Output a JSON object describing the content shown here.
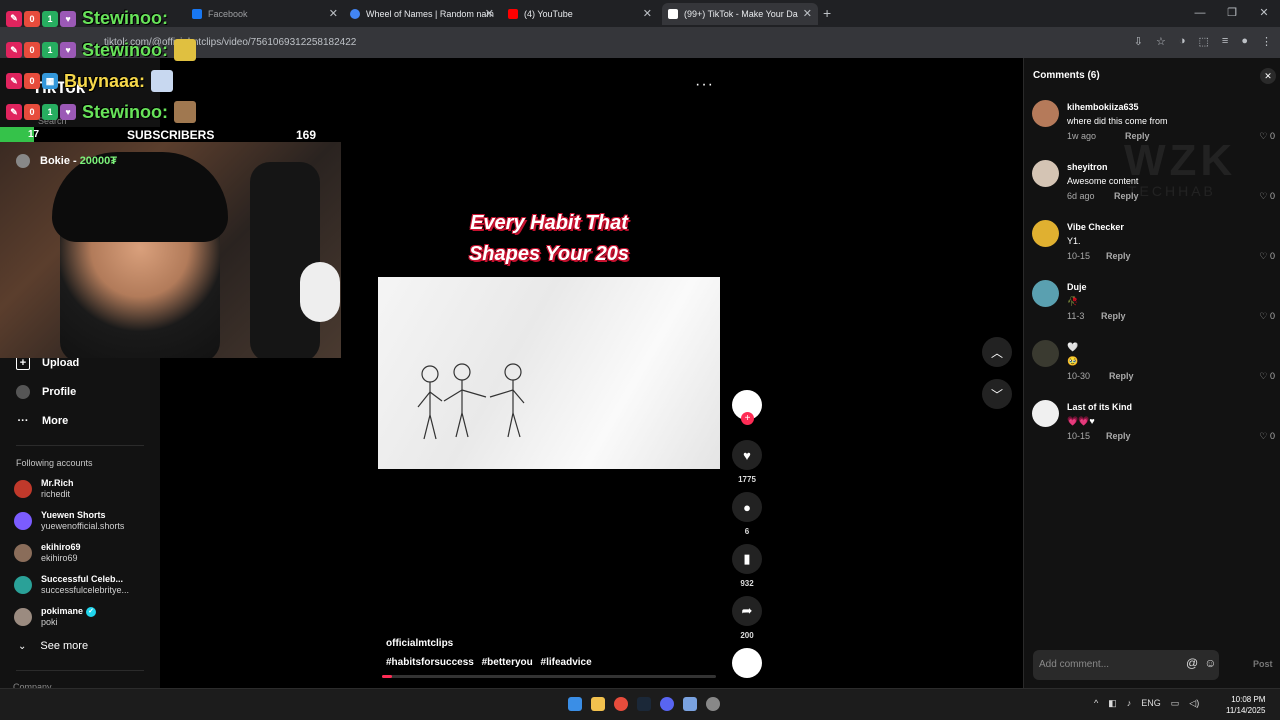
{
  "browser": {
    "tabs": [
      {
        "label": "Facebook",
        "color": "#1877f2"
      },
      {
        "label": "Wheel of Names | Random nam",
        "color": "#4285f4"
      },
      {
        "label": "(4) YouTube",
        "color": "#ff0000"
      },
      {
        "label": "(99+) TikTok - Make Your Da",
        "color": "#ffffff"
      }
    ],
    "new_tab": "+",
    "url": "tiktok.com/@officialmtclips/video/7561069312258182422",
    "win_buttons": [
      "—",
      "❐",
      "✕"
    ]
  },
  "stream_overlay": {
    "chat": [
      {
        "name": "Stewinoo:",
        "style": "green"
      },
      {
        "name": "Stewinoo:",
        "style": "green"
      },
      {
        "name": "Buynaaa:",
        "style": "yellow"
      },
      {
        "name": "Stewinoo:",
        "style": "green"
      }
    ],
    "subs": {
      "current": "17",
      "label": "SUBSCRIBERS",
      "goal": "169",
      "progress": 0.1
    },
    "webcam_hud": {
      "name": "Bokie -",
      "amount": "20000₮"
    }
  },
  "sidebar": {
    "logo": "TikTok",
    "search_placeholder": "Search",
    "nav": [
      {
        "label": "Upload",
        "icon": "+"
      },
      {
        "label": "Profile",
        "icon": "●"
      },
      {
        "label": "More",
        "icon": "···"
      }
    ],
    "following_title": "Following accounts",
    "following": [
      {
        "name": "Mr.Rich",
        "handle": "richedit",
        "color": "#c0392b",
        "verified": false
      },
      {
        "name": "Yuewen Shorts",
        "handle": "yuewenofficial.shorts",
        "color": "#7b5cff",
        "verified": false
      },
      {
        "name": "ekihiro69",
        "handle": "ekihiro69",
        "color": "#8a6d5a",
        "verified": false
      },
      {
        "name": "Successful Celeb...",
        "handle": "successfulcelebritye...",
        "color": "#2aa198",
        "verified": false
      },
      {
        "name": "pokimane",
        "handle": "poki",
        "color": "#9b8b80",
        "verified": true
      }
    ],
    "see_more": "See more",
    "company": "Company"
  },
  "video": {
    "more": "···",
    "title_line1": "Every Habit That",
    "title_line2": "Shapes Your 20s",
    "username": "officialmtclips",
    "hashtags": [
      "#habitsforsuccess",
      "#betteryou",
      "#lifeadvice"
    ],
    "progress": 0.03,
    "likes": "1775",
    "comments": "6",
    "saves": "932",
    "shares": "200"
  },
  "comments_panel": {
    "title": "Comments (6)",
    "placeholder": "Add comment...",
    "post": "Post",
    "items": [
      {
        "user": "kihembokiiza635",
        "text": "where did this come from",
        "date": "1w ago",
        "reply": "Reply",
        "likes": "0",
        "color": "#b57a5a"
      },
      {
        "user": "sheyitron",
        "text": "Awesome content",
        "date": "6d ago",
        "reply": "Reply",
        "likes": "0",
        "color": "#d4c4b4"
      },
      {
        "user": "Vibe Checker",
        "text": "Y1.",
        "date": "10-15",
        "reply": "Reply",
        "likes": "0",
        "color": "#e0b030"
      },
      {
        "user": "Duje",
        "text": "🥀",
        "date": "11-3",
        "reply": "Reply",
        "likes": "0",
        "color": "#5aa0b0"
      },
      {
        "user": "🤍",
        "text": "🥹",
        "date": "10-30",
        "reply": "Reply",
        "likes": "0",
        "color": "#3a3a30"
      },
      {
        "user": "Last of its Kind",
        "text": "💗💗♥",
        "date": "10-15",
        "reply": "Reply",
        "likes": "0",
        "color": "#f0f0f0"
      }
    ],
    "watermark": "WZK",
    "watermark_sub": "TECHHAB"
  },
  "taskbar": {
    "lang": "ENG",
    "time": "10:08 PM",
    "date": "11/14/2025"
  }
}
